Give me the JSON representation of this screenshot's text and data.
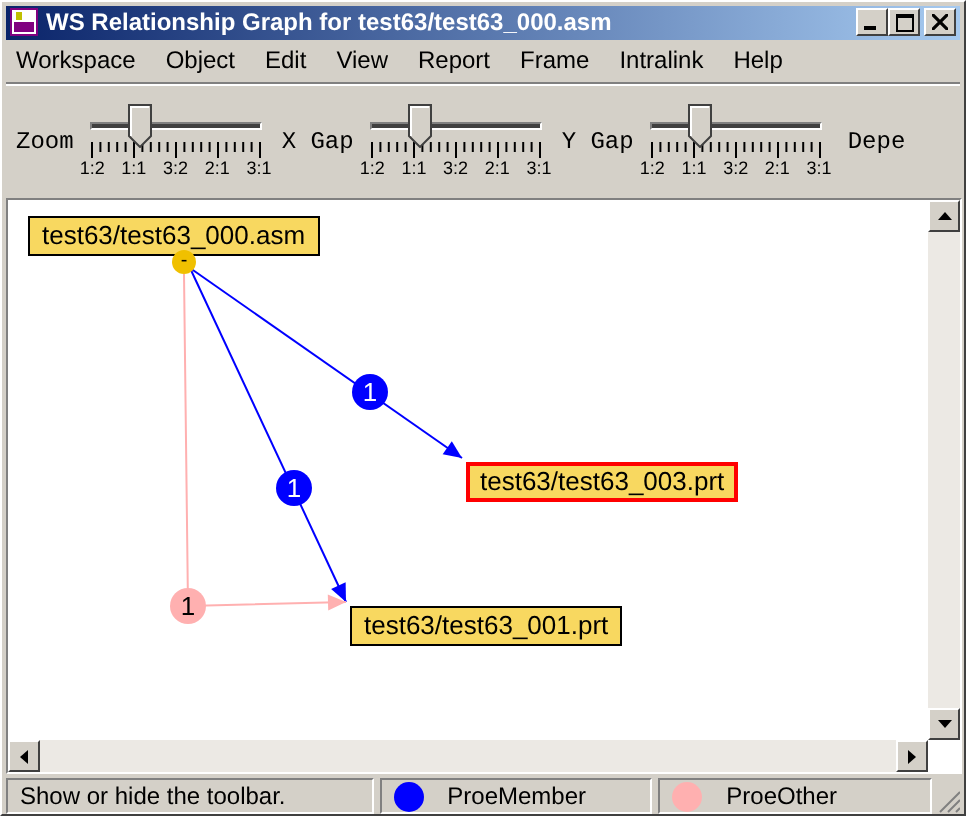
{
  "window": {
    "title": "WS Relationship Graph for test63/test63_000.asm"
  },
  "menu": [
    "Workspace",
    "Object",
    "Edit",
    "View",
    "Report",
    "Frame",
    "Intralink",
    "Help"
  ],
  "sliders": [
    {
      "label": "Zoom",
      "level": 0.22,
      "ticks": [
        "1:2",
        "1:1",
        "3:2",
        "2:1",
        "3:1"
      ]
    },
    {
      "label": "X Gap",
      "level": 0.22,
      "ticks": [
        "1:2",
        "1:1",
        "3:2",
        "2:1",
        "3:1"
      ]
    },
    {
      "label": "Y Gap",
      "level": 0.22,
      "ticks": [
        "1:2",
        "1:1",
        "3:2",
        "2:1",
        "3:1"
      ]
    }
  ],
  "toolbar_cut_label": "Depe",
  "graph": {
    "nodes": [
      {
        "label": "test63/test63_000.asm",
        "selected": false,
        "toggle": "-"
      },
      {
        "label": "test63/test63_003.prt",
        "selected": true
      },
      {
        "label": "test63/test63_001.prt",
        "selected": false
      }
    ],
    "edges": [
      {
        "kind": "member",
        "count": "1"
      },
      {
        "kind": "member",
        "count": "1"
      },
      {
        "kind": "other",
        "count": "1"
      }
    ]
  },
  "status_bar": {
    "message": "Show or hide the toolbar.",
    "legend": [
      {
        "label": "ProeMember",
        "color": "#0000ff"
      },
      {
        "label": "ProeOther",
        "color": "#ffb0b0"
      }
    ]
  }
}
